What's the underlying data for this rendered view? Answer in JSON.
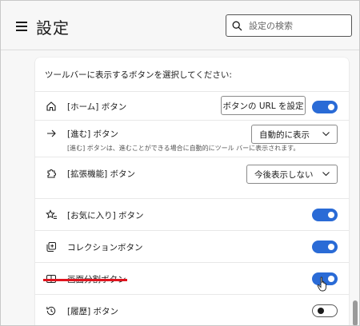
{
  "header": {
    "title": "設定",
    "search_placeholder": "設定の検索"
  },
  "section": {
    "heading": "ツールバーに表示するボタンを選択してください:"
  },
  "rows": {
    "home": {
      "icon": "home-icon",
      "label": "[ホーム] ボタン",
      "button_label": "ボタンの URL を設定",
      "toggle_on": true
    },
    "forward": {
      "icon": "arrow-right-icon",
      "label": "[進む] ボタン",
      "sub": "[進む] ボタンは、進むことができる場合に自動的にツール バーに表示されます。",
      "dropdown_value": "自動的に表示"
    },
    "extensions": {
      "icon": "puzzle-icon",
      "label": "[拡張機能] ボタン",
      "dropdown_value": "今後表示しない"
    },
    "favorites": {
      "icon": "favorites-icon",
      "label": "[お気に入り] ボタン",
      "toggle_on": true
    },
    "collections": {
      "icon": "collections-icon",
      "label": "コレクションボタン",
      "toggle_on": true
    },
    "split_screen": {
      "icon": "split-screen-icon",
      "label": "画面分割ボタン",
      "toggle_on": true
    },
    "history": {
      "icon": "history-icon",
      "label": "[履歴] ボタン",
      "toggle_on": false
    }
  },
  "colors": {
    "toggle_on": "#2a6bd6",
    "annotation": "#e0141e"
  }
}
